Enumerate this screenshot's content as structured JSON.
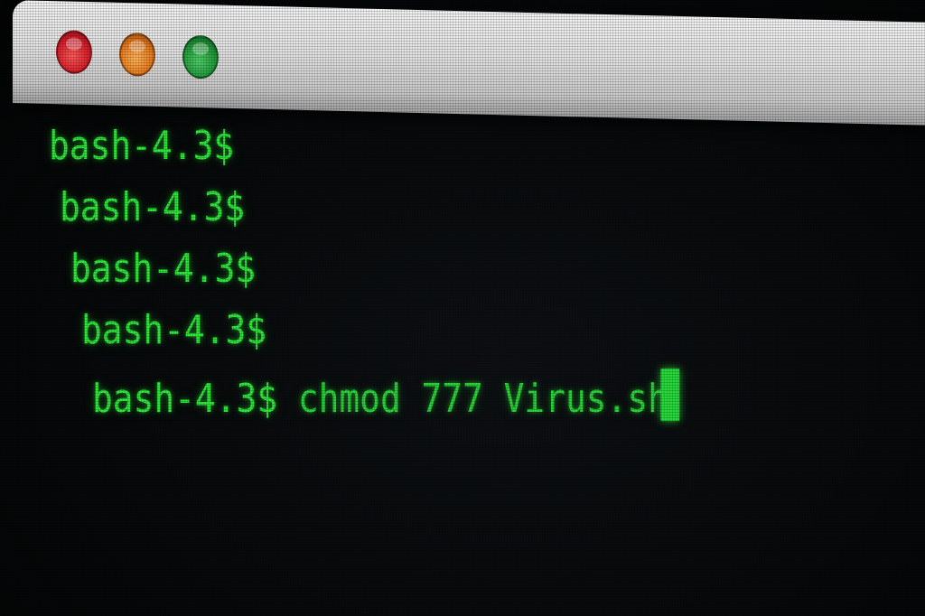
{
  "window": {
    "buttons": [
      {
        "name": "close",
        "color": "#d81f2a"
      },
      {
        "name": "minimize",
        "color": "#e87a1c"
      },
      {
        "name": "zoom",
        "color": "#219a3a"
      }
    ]
  },
  "terminal": {
    "text_color": "#2ee53c",
    "lines": [
      {
        "prompt": "bash-4.3$",
        "command": ""
      },
      {
        "prompt": "bash-4.3$",
        "command": ""
      },
      {
        "prompt": "bash-4.3$",
        "command": ""
      },
      {
        "prompt": "bash-4.3$",
        "command": ""
      },
      {
        "prompt": "bash-4.3$",
        "command": " chmod 777 Virus.sh"
      }
    ]
  }
}
